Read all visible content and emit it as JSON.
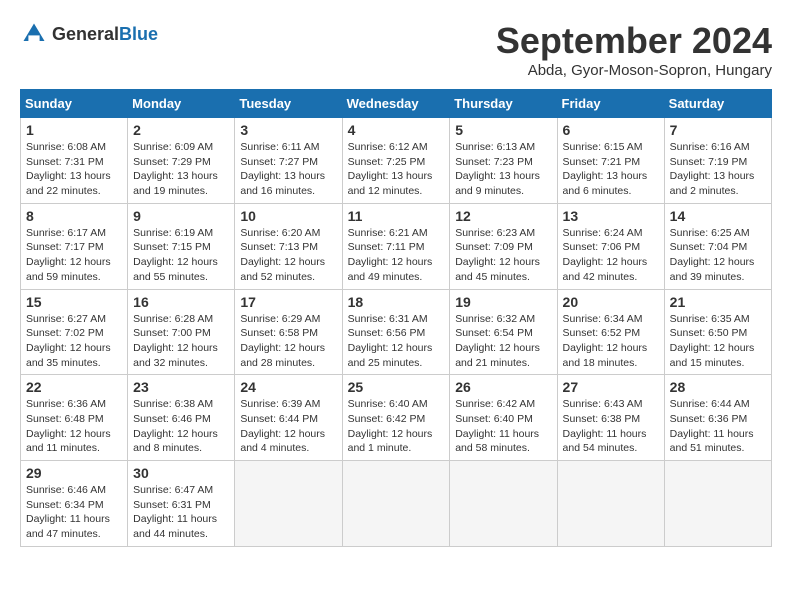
{
  "logo": {
    "text_general": "General",
    "text_blue": "Blue"
  },
  "header": {
    "month_title": "September 2024",
    "location": "Abda, Gyor-Moson-Sopron, Hungary"
  },
  "weekdays": [
    "Sunday",
    "Monday",
    "Tuesday",
    "Wednesday",
    "Thursday",
    "Friday",
    "Saturday"
  ],
  "weeks": [
    [
      {
        "day": "1",
        "sunrise": "6:08 AM",
        "sunset": "7:31 PM",
        "daylight": "13 hours and 22 minutes."
      },
      {
        "day": "2",
        "sunrise": "6:09 AM",
        "sunset": "7:29 PM",
        "daylight": "13 hours and 19 minutes."
      },
      {
        "day": "3",
        "sunrise": "6:11 AM",
        "sunset": "7:27 PM",
        "daylight": "13 hours and 16 minutes."
      },
      {
        "day": "4",
        "sunrise": "6:12 AM",
        "sunset": "7:25 PM",
        "daylight": "13 hours and 12 minutes."
      },
      {
        "day": "5",
        "sunrise": "6:13 AM",
        "sunset": "7:23 PM",
        "daylight": "13 hours and 9 minutes."
      },
      {
        "day": "6",
        "sunrise": "6:15 AM",
        "sunset": "7:21 PM",
        "daylight": "13 hours and 6 minutes."
      },
      {
        "day": "7",
        "sunrise": "6:16 AM",
        "sunset": "7:19 PM",
        "daylight": "13 hours and 2 minutes."
      }
    ],
    [
      {
        "day": "8",
        "sunrise": "6:17 AM",
        "sunset": "7:17 PM",
        "daylight": "12 hours and 59 minutes."
      },
      {
        "day": "9",
        "sunrise": "6:19 AM",
        "sunset": "7:15 PM",
        "daylight": "12 hours and 55 minutes."
      },
      {
        "day": "10",
        "sunrise": "6:20 AM",
        "sunset": "7:13 PM",
        "daylight": "12 hours and 52 minutes."
      },
      {
        "day": "11",
        "sunrise": "6:21 AM",
        "sunset": "7:11 PM",
        "daylight": "12 hours and 49 minutes."
      },
      {
        "day": "12",
        "sunrise": "6:23 AM",
        "sunset": "7:09 PM",
        "daylight": "12 hours and 45 minutes."
      },
      {
        "day": "13",
        "sunrise": "6:24 AM",
        "sunset": "7:06 PM",
        "daylight": "12 hours and 42 minutes."
      },
      {
        "day": "14",
        "sunrise": "6:25 AM",
        "sunset": "7:04 PM",
        "daylight": "12 hours and 39 minutes."
      }
    ],
    [
      {
        "day": "15",
        "sunrise": "6:27 AM",
        "sunset": "7:02 PM",
        "daylight": "12 hours and 35 minutes."
      },
      {
        "day": "16",
        "sunrise": "6:28 AM",
        "sunset": "7:00 PM",
        "daylight": "12 hours and 32 minutes."
      },
      {
        "day": "17",
        "sunrise": "6:29 AM",
        "sunset": "6:58 PM",
        "daylight": "12 hours and 28 minutes."
      },
      {
        "day": "18",
        "sunrise": "6:31 AM",
        "sunset": "6:56 PM",
        "daylight": "12 hours and 25 minutes."
      },
      {
        "day": "19",
        "sunrise": "6:32 AM",
        "sunset": "6:54 PM",
        "daylight": "12 hours and 21 minutes."
      },
      {
        "day": "20",
        "sunrise": "6:34 AM",
        "sunset": "6:52 PM",
        "daylight": "12 hours and 18 minutes."
      },
      {
        "day": "21",
        "sunrise": "6:35 AM",
        "sunset": "6:50 PM",
        "daylight": "12 hours and 15 minutes."
      }
    ],
    [
      {
        "day": "22",
        "sunrise": "6:36 AM",
        "sunset": "6:48 PM",
        "daylight": "12 hours and 11 minutes."
      },
      {
        "day": "23",
        "sunrise": "6:38 AM",
        "sunset": "6:46 PM",
        "daylight": "12 hours and 8 minutes."
      },
      {
        "day": "24",
        "sunrise": "6:39 AM",
        "sunset": "6:44 PM",
        "daylight": "12 hours and 4 minutes."
      },
      {
        "day": "25",
        "sunrise": "6:40 AM",
        "sunset": "6:42 PM",
        "daylight": "12 hours and 1 minute."
      },
      {
        "day": "26",
        "sunrise": "6:42 AM",
        "sunset": "6:40 PM",
        "daylight": "11 hours and 58 minutes."
      },
      {
        "day": "27",
        "sunrise": "6:43 AM",
        "sunset": "6:38 PM",
        "daylight": "11 hours and 54 minutes."
      },
      {
        "day": "28",
        "sunrise": "6:44 AM",
        "sunset": "6:36 PM",
        "daylight": "11 hours and 51 minutes."
      }
    ],
    [
      {
        "day": "29",
        "sunrise": "6:46 AM",
        "sunset": "6:34 PM",
        "daylight": "11 hours and 47 minutes."
      },
      {
        "day": "30",
        "sunrise": "6:47 AM",
        "sunset": "6:31 PM",
        "daylight": "11 hours and 44 minutes."
      },
      null,
      null,
      null,
      null,
      null
    ]
  ]
}
